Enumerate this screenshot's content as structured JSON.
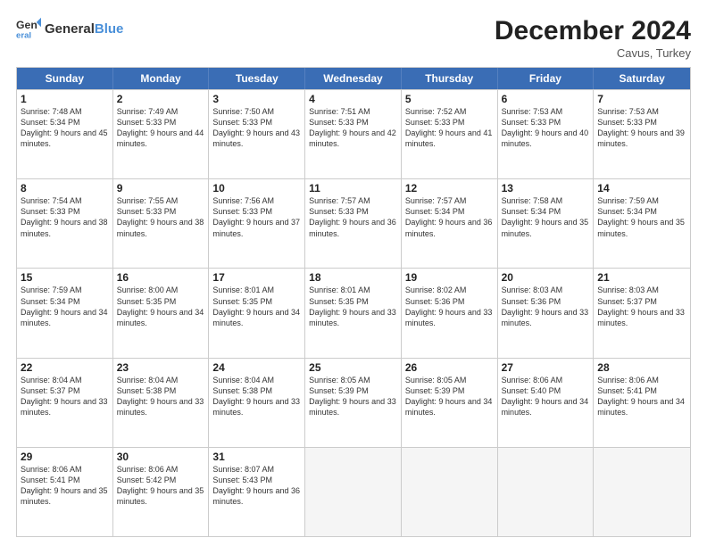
{
  "logo": {
    "general": "General",
    "blue": "Blue"
  },
  "header": {
    "month": "December 2024",
    "location": "Cavus, Turkey"
  },
  "days": [
    "Sunday",
    "Monday",
    "Tuesday",
    "Wednesday",
    "Thursday",
    "Friday",
    "Saturday"
  ],
  "weeks": [
    [
      {
        "day": 1,
        "sunrise": "Sunrise: 7:48 AM",
        "sunset": "Sunset: 5:34 PM",
        "daylight": "Daylight: 9 hours and 45 minutes."
      },
      {
        "day": 2,
        "sunrise": "Sunrise: 7:49 AM",
        "sunset": "Sunset: 5:33 PM",
        "daylight": "Daylight: 9 hours and 44 minutes."
      },
      {
        "day": 3,
        "sunrise": "Sunrise: 7:50 AM",
        "sunset": "Sunset: 5:33 PM",
        "daylight": "Daylight: 9 hours and 43 minutes."
      },
      {
        "day": 4,
        "sunrise": "Sunrise: 7:51 AM",
        "sunset": "Sunset: 5:33 PM",
        "daylight": "Daylight: 9 hours and 42 minutes."
      },
      {
        "day": 5,
        "sunrise": "Sunrise: 7:52 AM",
        "sunset": "Sunset: 5:33 PM",
        "daylight": "Daylight: 9 hours and 41 minutes."
      },
      {
        "day": 6,
        "sunrise": "Sunrise: 7:53 AM",
        "sunset": "Sunset: 5:33 PM",
        "daylight": "Daylight: 9 hours and 40 minutes."
      },
      {
        "day": 7,
        "sunrise": "Sunrise: 7:53 AM",
        "sunset": "Sunset: 5:33 PM",
        "daylight": "Daylight: 9 hours and 39 minutes."
      }
    ],
    [
      {
        "day": 8,
        "sunrise": "Sunrise: 7:54 AM",
        "sunset": "Sunset: 5:33 PM",
        "daylight": "Daylight: 9 hours and 38 minutes."
      },
      {
        "day": 9,
        "sunrise": "Sunrise: 7:55 AM",
        "sunset": "Sunset: 5:33 PM",
        "daylight": "Daylight: 9 hours and 38 minutes."
      },
      {
        "day": 10,
        "sunrise": "Sunrise: 7:56 AM",
        "sunset": "Sunset: 5:33 PM",
        "daylight": "Daylight: 9 hours and 37 minutes."
      },
      {
        "day": 11,
        "sunrise": "Sunrise: 7:57 AM",
        "sunset": "Sunset: 5:33 PM",
        "daylight": "Daylight: 9 hours and 36 minutes."
      },
      {
        "day": 12,
        "sunrise": "Sunrise: 7:57 AM",
        "sunset": "Sunset: 5:34 PM",
        "daylight": "Daylight: 9 hours and 36 minutes."
      },
      {
        "day": 13,
        "sunrise": "Sunrise: 7:58 AM",
        "sunset": "Sunset: 5:34 PM",
        "daylight": "Daylight: 9 hours and 35 minutes."
      },
      {
        "day": 14,
        "sunrise": "Sunrise: 7:59 AM",
        "sunset": "Sunset: 5:34 PM",
        "daylight": "Daylight: 9 hours and 35 minutes."
      }
    ],
    [
      {
        "day": 15,
        "sunrise": "Sunrise: 7:59 AM",
        "sunset": "Sunset: 5:34 PM",
        "daylight": "Daylight: 9 hours and 34 minutes."
      },
      {
        "day": 16,
        "sunrise": "Sunrise: 8:00 AM",
        "sunset": "Sunset: 5:35 PM",
        "daylight": "Daylight: 9 hours and 34 minutes."
      },
      {
        "day": 17,
        "sunrise": "Sunrise: 8:01 AM",
        "sunset": "Sunset: 5:35 PM",
        "daylight": "Daylight: 9 hours and 34 minutes."
      },
      {
        "day": 18,
        "sunrise": "Sunrise: 8:01 AM",
        "sunset": "Sunset: 5:35 PM",
        "daylight": "Daylight: 9 hours and 33 minutes."
      },
      {
        "day": 19,
        "sunrise": "Sunrise: 8:02 AM",
        "sunset": "Sunset: 5:36 PM",
        "daylight": "Daylight: 9 hours and 33 minutes."
      },
      {
        "day": 20,
        "sunrise": "Sunrise: 8:03 AM",
        "sunset": "Sunset: 5:36 PM",
        "daylight": "Daylight: 9 hours and 33 minutes."
      },
      {
        "day": 21,
        "sunrise": "Sunrise: 8:03 AM",
        "sunset": "Sunset: 5:37 PM",
        "daylight": "Daylight: 9 hours and 33 minutes."
      }
    ],
    [
      {
        "day": 22,
        "sunrise": "Sunrise: 8:04 AM",
        "sunset": "Sunset: 5:37 PM",
        "daylight": "Daylight: 9 hours and 33 minutes."
      },
      {
        "day": 23,
        "sunrise": "Sunrise: 8:04 AM",
        "sunset": "Sunset: 5:38 PM",
        "daylight": "Daylight: 9 hours and 33 minutes."
      },
      {
        "day": 24,
        "sunrise": "Sunrise: 8:04 AM",
        "sunset": "Sunset: 5:38 PM",
        "daylight": "Daylight: 9 hours and 33 minutes."
      },
      {
        "day": 25,
        "sunrise": "Sunrise: 8:05 AM",
        "sunset": "Sunset: 5:39 PM",
        "daylight": "Daylight: 9 hours and 33 minutes."
      },
      {
        "day": 26,
        "sunrise": "Sunrise: 8:05 AM",
        "sunset": "Sunset: 5:39 PM",
        "daylight": "Daylight: 9 hours and 34 minutes."
      },
      {
        "day": 27,
        "sunrise": "Sunrise: 8:06 AM",
        "sunset": "Sunset: 5:40 PM",
        "daylight": "Daylight: 9 hours and 34 minutes."
      },
      {
        "day": 28,
        "sunrise": "Sunrise: 8:06 AM",
        "sunset": "Sunset: 5:41 PM",
        "daylight": "Daylight: 9 hours and 34 minutes."
      }
    ],
    [
      {
        "day": 29,
        "sunrise": "Sunrise: 8:06 AM",
        "sunset": "Sunset: 5:41 PM",
        "daylight": "Daylight: 9 hours and 35 minutes."
      },
      {
        "day": 30,
        "sunrise": "Sunrise: 8:06 AM",
        "sunset": "Sunset: 5:42 PM",
        "daylight": "Daylight: 9 hours and 35 minutes."
      },
      {
        "day": 31,
        "sunrise": "Sunrise: 8:07 AM",
        "sunset": "Sunset: 5:43 PM",
        "daylight": "Daylight: 9 hours and 36 minutes."
      },
      null,
      null,
      null,
      null
    ]
  ]
}
